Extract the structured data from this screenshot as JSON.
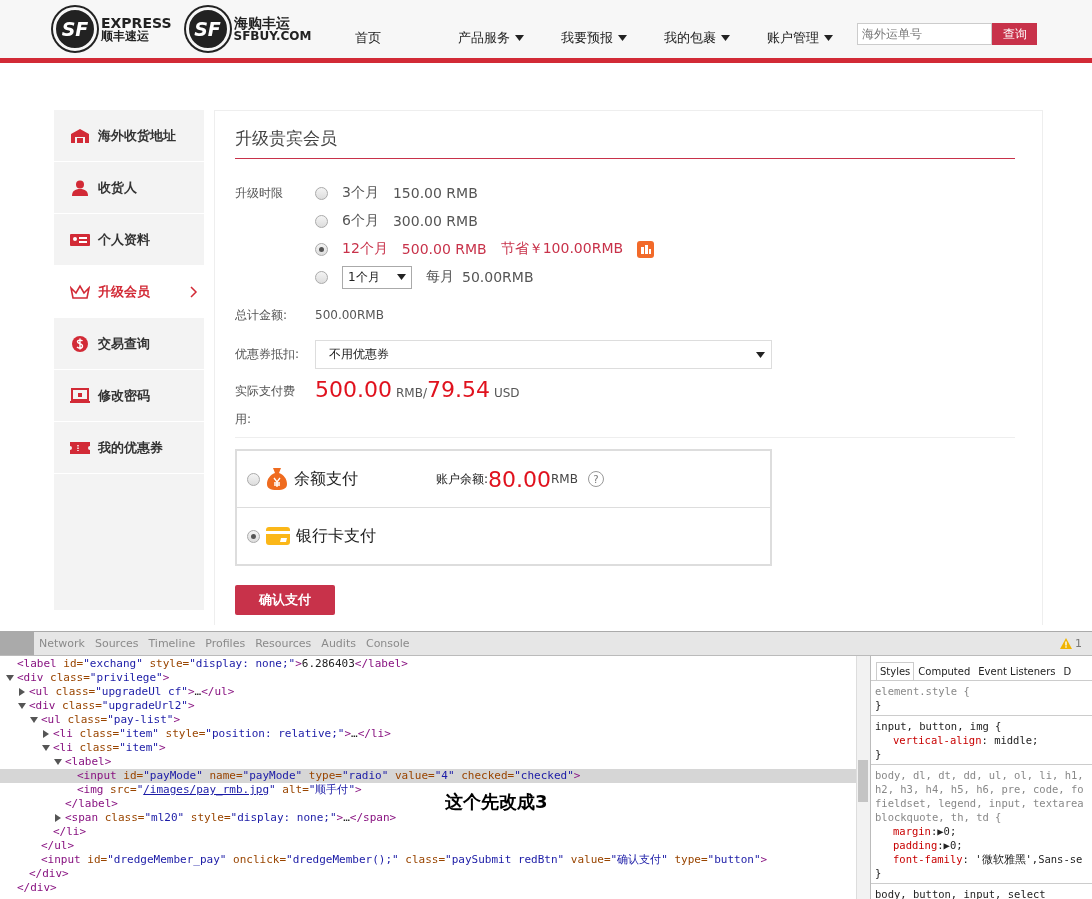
{
  "header": {
    "logos": [
      {
        "mark": "SF",
        "line1": "EXPRESS",
        "line2": "顺丰速运"
      },
      {
        "mark": "SF",
        "line1": "海购丰运",
        "line2": "SFBUY.COM"
      }
    ],
    "nav": [
      {
        "label": "首页",
        "dropdown": false
      },
      {
        "label": "产品服务",
        "dropdown": true
      },
      {
        "label": "我要预报",
        "dropdown": true
      },
      {
        "label": "我的包裹",
        "dropdown": true
      },
      {
        "label": "账户管理",
        "dropdown": true
      }
    ],
    "search": {
      "placeholder": "海外运单号",
      "button": "查询"
    }
  },
  "sidebar": {
    "items": [
      {
        "kind": "warehouse",
        "label": "海外收货地址",
        "selected": false
      },
      {
        "kind": "person",
        "label": "收货人",
        "selected": false
      },
      {
        "kind": "idcard",
        "label": "个人资料",
        "selected": false
      },
      {
        "kind": "crown",
        "label": "升级会员",
        "selected": true
      },
      {
        "kind": "dollar",
        "label": "交易查询",
        "selected": false
      },
      {
        "kind": "laptop",
        "label": "修改密码",
        "selected": false
      },
      {
        "kind": "coupon",
        "label": "我的优惠券",
        "selected": false
      }
    ]
  },
  "form": {
    "title": "升级贵宾会员",
    "duration_label": "升级时限",
    "durations": [
      {
        "kind": "fixed",
        "months": "3个月",
        "price": "150.00 RMB",
        "selected": false
      },
      {
        "kind": "fixed",
        "months": "6个月",
        "price": "300.00 RMB",
        "selected": false
      },
      {
        "kind": "fixed",
        "months": "12个月",
        "price": "500.00 RMB",
        "saving": "节省￥100.00RMB",
        "selected": true
      },
      {
        "kind": "select",
        "select_value": "1个月",
        "per_label": "每月",
        "price": "50.00RMB",
        "selected": false
      }
    ],
    "total_label": "总计金额:",
    "total_value": "500.00RMB",
    "coupon_label": "优惠券抵扣:",
    "coupon_value": "不用优惠券",
    "actual_label": "实际支付费用:",
    "actual_rmb": "500.00",
    "rmb_unit": "RMB/",
    "actual_usd": "79.54",
    "usd_unit": "USD",
    "payments": [
      {
        "kind": "moneybag",
        "label": "余额支付",
        "selected": false,
        "balance_label": "账户余额:",
        "balance": "80.00",
        "balance_unit": "RMB",
        "help": "?"
      },
      {
        "kind": "card",
        "label": "银行卡支付",
        "selected": true
      }
    ],
    "submit": "确认支付"
  },
  "devtools": {
    "tabs": [
      "Network",
      "Sources",
      "Timeline",
      "Profiles",
      "Resources",
      "Audits",
      "Console"
    ],
    "warning_count": "1",
    "dom": [
      {
        "selected": false,
        "tokens": [
          {
            "kind": "tag",
            "text": "<label"
          },
          {
            "kind": "attr",
            "text": " id="
          },
          {
            "kind": "val",
            "text": "\"exchang\""
          },
          {
            "kind": "attr",
            "text": " style="
          },
          {
            "kind": "val",
            "text": "\"display: none;\""
          },
          {
            "kind": "tag",
            "text": ">"
          },
          {
            "kind": "text",
            "text": "6.286403"
          },
          {
            "kind": "tag",
            "text": "</label>"
          }
        ]
      },
      {
        "selected": false,
        "expanded": true,
        "tokens": [
          {
            "kind": "tag",
            "text": "<div"
          },
          {
            "kind": "attr",
            "text": " class="
          },
          {
            "kind": "val",
            "text": "\"privilege\""
          },
          {
            "kind": "tag",
            "text": ">"
          }
        ],
        "close": [
          {
            "kind": "tag",
            "text": "</div>"
          }
        ],
        "children": [
          {
            "selected": false,
            "expanded": false,
            "tokens": [
              {
                "kind": "tag",
                "text": "<ul"
              },
              {
                "kind": "attr",
                "text": " class="
              },
              {
                "kind": "val",
                "text": "\"upgradeUl cf\""
              },
              {
                "kind": "tag",
                "text": ">"
              },
              {
                "kind": "text",
                "text": "…"
              },
              {
                "kind": "tag",
                "text": "</ul>"
              }
            ]
          },
          {
            "selected": false,
            "expanded": true,
            "tokens": [
              {
                "kind": "tag",
                "text": "<div"
              },
              {
                "kind": "attr",
                "text": " class="
              },
              {
                "kind": "val",
                "text": "\"upgradeUrl2\""
              },
              {
                "kind": "tag",
                "text": ">"
              }
            ],
            "close": [
              {
                "kind": "tag",
                "text": "</div>"
              }
            ],
            "children": [
              {
                "selected": false,
                "expanded": true,
                "tokens": [
                  {
                    "kind": "tag",
                    "text": "<ul"
                  },
                  {
                    "kind": "attr",
                    "text": " class="
                  },
                  {
                    "kind": "val",
                    "text": "\"pay-list\""
                  },
                  {
                    "kind": "tag",
                    "text": ">"
                  }
                ],
                "close": [
                  {
                    "kind": "tag",
                    "text": "</ul>"
                  }
                ],
                "children": [
                  {
                    "selected": false,
                    "expanded": false,
                    "tokens": [
                      {
                        "kind": "tag",
                        "text": "<li"
                      },
                      {
                        "kind": "attr",
                        "text": " class="
                      },
                      {
                        "kind": "val",
                        "text": "\"item\""
                      },
                      {
                        "kind": "attr",
                        "text": " style="
                      },
                      {
                        "kind": "val",
                        "text": "\"position: relative;\""
                      },
                      {
                        "kind": "tag",
                        "text": ">"
                      },
                      {
                        "kind": "text",
                        "text": "…"
                      },
                      {
                        "kind": "tag",
                        "text": "</li>"
                      }
                    ]
                  },
                  {
                    "selected": false,
                    "expanded": true,
                    "tokens": [
                      {
                        "kind": "tag",
                        "text": "<li"
                      },
                      {
                        "kind": "attr",
                        "text": " class="
                      },
                      {
                        "kind": "val",
                        "text": "\"item\""
                      },
                      {
                        "kind": "tag",
                        "text": ">"
                      }
                    ],
                    "close": [
                      {
                        "kind": "tag",
                        "text": "</li>"
                      }
                    ],
                    "children": [
                      {
                        "selected": false,
                        "expanded": true,
                        "tokens": [
                          {
                            "kind": "tag",
                            "text": "<label>"
                          }
                        ],
                        "close": [
                          {
                            "kind": "tag",
                            "text": "</label>"
                          }
                        ],
                        "children": [
                          {
                            "selected": true,
                            "tokens": [
                              {
                                "kind": "tag",
                                "text": "<input"
                              },
                              {
                                "kind": "attr",
                                "text": " id="
                              },
                              {
                                "kind": "val",
                                "text": "\"payMode\""
                              },
                              {
                                "kind": "attr",
                                "text": " name="
                              },
                              {
                                "kind": "val",
                                "text": "\"payMode\""
                              },
                              {
                                "kind": "attr",
                                "text": " type="
                              },
                              {
                                "kind": "val",
                                "text": "\"radio\""
                              },
                              {
                                "kind": "attr",
                                "text": " value="
                              },
                              {
                                "kind": "val",
                                "text": "\"4\""
                              },
                              {
                                "kind": "attr",
                                "text": " checked="
                              },
                              {
                                "kind": "val",
                                "text": "\"checked\""
                              },
                              {
                                "kind": "tag",
                                "text": ">"
                              }
                            ]
                          },
                          {
                            "selected": false,
                            "tokens": [
                              {
                                "kind": "tag",
                                "text": "<img"
                              },
                              {
                                "kind": "attr",
                                "text": " src="
                              },
                              {
                                "kind": "val",
                                "text": "\""
                              },
                              {
                                "kind": "link",
                                "text": "/images/pay_rmb.jpg"
                              },
                              {
                                "kind": "val",
                                "text": "\""
                              },
                              {
                                "kind": "attr",
                                "text": " alt="
                              },
                              {
                                "kind": "val",
                                "text": "\"顺手付\""
                              },
                              {
                                "kind": "tag",
                                "text": ">"
                              }
                            ]
                          }
                        ]
                      },
                      {
                        "selected": false,
                        "expanded": false,
                        "tokens": [
                          {
                            "kind": "tag",
                            "text": "<span"
                          },
                          {
                            "kind": "attr",
                            "text": " class="
                          },
                          {
                            "kind": "val",
                            "text": "\"ml20\""
                          },
                          {
                            "kind": "attr",
                            "text": " style="
                          },
                          {
                            "kind": "val",
                            "text": "\"display: none;\""
                          },
                          {
                            "kind": "tag",
                            "text": ">"
                          },
                          {
                            "kind": "text",
                            "text": "…"
                          },
                          {
                            "kind": "tag",
                            "text": "</span>"
                          }
                        ]
                      }
                    ]
                  }
                ]
              },
              {
                "selected": false,
                "tokens": [
                  {
                    "kind": "tag",
                    "text": "<input"
                  },
                  {
                    "kind": "attr",
                    "text": " id="
                  },
                  {
                    "kind": "val",
                    "text": "\"dredgeMember_pay\""
                  },
                  {
                    "kind": "attr",
                    "text": " onclick="
                  },
                  {
                    "kind": "val",
                    "text": "\"dredgeMember();\""
                  },
                  {
                    "kind": "attr",
                    "text": " class="
                  },
                  {
                    "kind": "val",
                    "text": "\"paySubmit redBtn\""
                  },
                  {
                    "kind": "attr",
                    "text": " value="
                  },
                  {
                    "kind": "val",
                    "text": "\"确认支付\""
                  },
                  {
                    "kind": "attr",
                    "text": " type="
                  },
                  {
                    "kind": "val",
                    "text": "\"button\""
                  },
                  {
                    "kind": "tag",
                    "text": ">"
                  }
                ]
              }
            ]
          }
        ]
      }
    ],
    "annotation": "这个先改成3",
    "style_tabs": [
      {
        "label": "Styles",
        "selected": true
      },
      {
        "label": "Computed",
        "selected": false
      },
      {
        "label": "Event Listeners",
        "selected": false
      },
      {
        "label": "D",
        "selected": false
      }
    ],
    "rules": [
      {
        "selector": "element.style {",
        "close": "}"
      },
      {
        "selector": "input, button, img {",
        "props": [
          {
            "name": "vertical-align",
            "value": ": middle;"
          }
        ],
        "close": "}"
      },
      {
        "selector_lines": [
          "body, dl, dt, dd, ul, ol, li, h1,",
          "h2, h3, h4, h5, h6, pre, code, fo",
          "fieldset, legend, input, textarea",
          "blockquote, th, td {"
        ],
        "props": [
          {
            "name": "margin",
            "value": ":▶0;"
          },
          {
            "name": "padding",
            "value": ":▶0;"
          },
          {
            "name": "font-family",
            "value": ": '微软雅黑',Sans-se"
          }
        ],
        "close": "}"
      },
      {
        "selector": "body, button, input, select"
      }
    ]
  }
}
